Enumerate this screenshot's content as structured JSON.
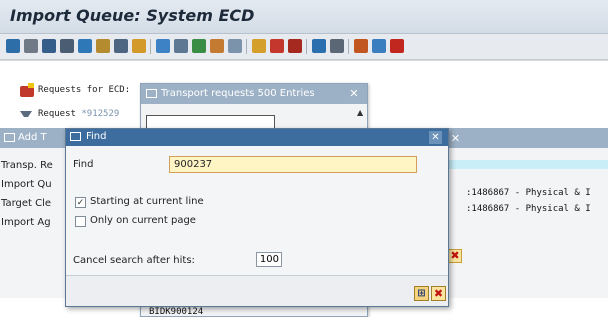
{
  "window": {
    "title": "Import Queue: System ECD"
  },
  "toolbar": {
    "icons": [
      "refresh-icon",
      "print-icon",
      "filter-icon",
      "find-icon",
      "zoom-icon",
      "sort-icon",
      "filter2-icon",
      "expand-icon",
      "arrow-icon",
      "doc-icon",
      "run-icon",
      "export-icon",
      "import-icon",
      "lock-icon",
      "truck-icon",
      "truck2-icon",
      "settings-icon",
      "layout-icon",
      "help-icon"
    ]
  },
  "main": {
    "requests_label": "Requests for ECD:",
    "filter_label_prefix": "Request",
    "filter_label_value": "*912529"
  },
  "transport_dialog": {
    "title": "Transport requests 500 Entries",
    "last_item": "BIDK900124"
  },
  "add_dialog": {
    "title": "Add T",
    "rows": [
      {
        "label": "Transp. Re"
      },
      {
        "label": "Import Qu"
      },
      {
        "label": "Target Cle"
      },
      {
        "label": "Import Ag"
      }
    ],
    "right_values": [
      ":1486867 - Physical & I",
      ":1486867 - Physical & I"
    ]
  },
  "find_dialog": {
    "title": "Find",
    "find_label": "Find",
    "find_value": "900237",
    "checkboxes": [
      {
        "label": "Starting at current line",
        "checked": true
      },
      {
        "label": "Only on current page",
        "checked": false
      }
    ],
    "cancel_label": "Cancel search after hits:",
    "cancel_value": "100"
  }
}
